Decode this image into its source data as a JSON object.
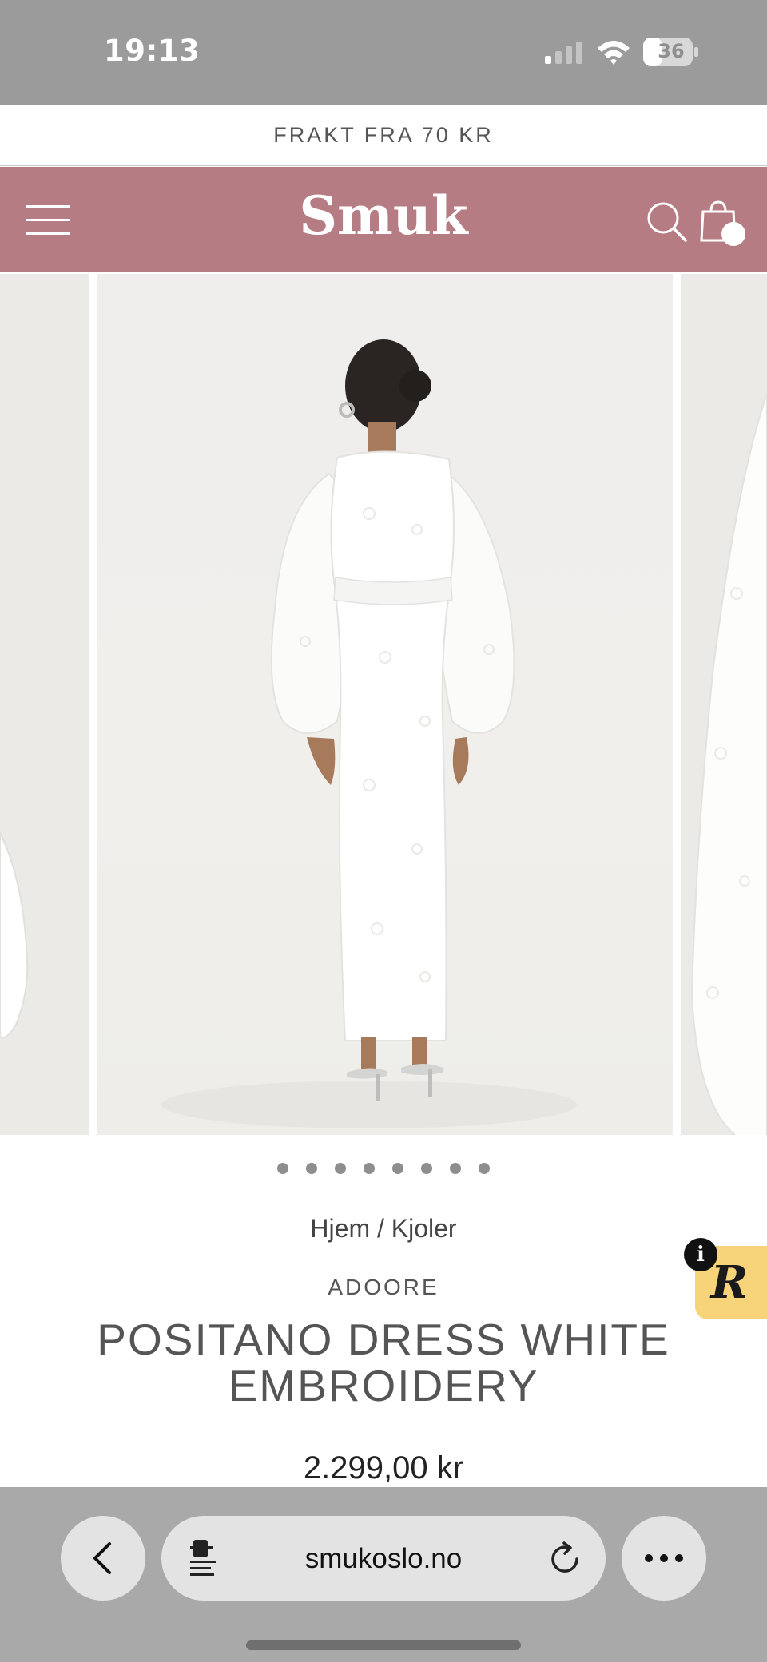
{
  "status_bar": {
    "time": "19:13",
    "battery": "36"
  },
  "announcement": {
    "text": "FRAKT FRA 70 KR"
  },
  "header": {
    "logo": "Smuk"
  },
  "carousel": {
    "slide_count": 8,
    "active_index": 0
  },
  "product": {
    "breadcrumb": "Hjem / Kjoler",
    "brand": "ADOORE",
    "title": "POSITANO DRESS WHITE EMBROIDERY",
    "price": "2.299,00 kr"
  },
  "reviews_widget": {
    "letter": "R",
    "info": "i"
  },
  "browser": {
    "url": "smukoslo.no"
  },
  "colors": {
    "header_bg": "#b67c83",
    "status_bar_bg": "#9b9b9b",
    "review_badge": "#f7d37a"
  }
}
